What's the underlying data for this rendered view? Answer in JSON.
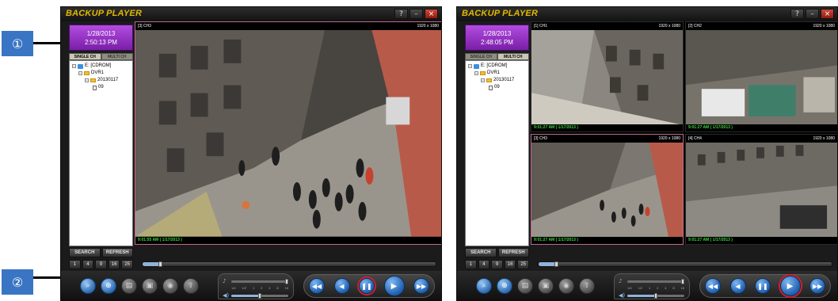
{
  "callouts": [
    "①",
    "②"
  ],
  "windows": [
    {
      "title": "BACKUP PLAYER",
      "controls": [
        "?",
        "–",
        "×"
      ],
      "date": "1/28/2013",
      "time": "2:50:13 PM",
      "tabs": [
        "SINGLE CH",
        "MULTI CH"
      ],
      "active_tab": "SINGLE CH",
      "tree": [
        "E: [CDROM]",
        "DVR1",
        "20130117",
        "09"
      ],
      "search_label": "SEARCH",
      "refresh_label": "REFRESH",
      "split_buttons": [
        "1",
        "4",
        "9",
        "16",
        "25"
      ],
      "timeline_position": 0.06,
      "volume_position": 0.5,
      "speed_position": 0.97,
      "volume_ticks": [
        "1/4",
        "1/2",
        "1",
        "2",
        "4",
        "8",
        "16"
      ],
      "layout": "single",
      "panes": [
        {
          "channel": "[3] CH3",
          "resolution": "1920 x 1080",
          "timestamp": "9:01:55 AM ( 1/17/2013 )",
          "border_color": "#c16a8c"
        }
      ],
      "icon_group": [
        "search-icon",
        "zoom-icon",
        "print-icon",
        "save-icon",
        "camera-icon",
        "export-icon"
      ],
      "highlighted_play_button": "pause",
      "colors": {
        "title": "#e3b800",
        "date_box": "#9b33c9",
        "timestamp": "#3bd63b",
        "play_ring": "#d01f2b"
      }
    },
    {
      "title": "BACKUP PLAYER",
      "controls": [
        "?",
        "–",
        "×"
      ],
      "date": "1/28/2013",
      "time": "2:48:05 PM",
      "tabs": [
        "SINGLE CH",
        "MULTI CH"
      ],
      "active_tab": "MULTI CH",
      "tree": [
        "E: [CDROM]",
        "DVR1",
        "20130117",
        "09"
      ],
      "search_label": "SEARCH",
      "refresh_label": "REFRESH",
      "split_buttons": [
        "1",
        "4",
        "9",
        "16",
        "25"
      ],
      "timeline_position": 0.06,
      "volume_position": 0.5,
      "speed_position": 0.97,
      "volume_ticks": [
        "1/4",
        "1/2",
        "1",
        "2",
        "4",
        "8",
        "16"
      ],
      "layout": "quad",
      "panes": [
        {
          "channel": "[1] CH1",
          "resolution": "1920 x 1080",
          "timestamp": "9:01:27 AM ( 1/17/2013 )",
          "border_color": "#2a2a2a"
        },
        {
          "channel": "[2] CH2",
          "resolution": "1920 x 1080",
          "timestamp": "9:01:27 AM ( 1/17/2013 )",
          "border_color": "#2a2a2a"
        },
        {
          "channel": "[3] CH3",
          "resolution": "1920 x 1080",
          "timestamp": "9:01:27 AM ( 1/17/2013 )",
          "border_color": "#c16a8c"
        },
        {
          "channel": "[4] CH4",
          "resolution": "1920 x 1080",
          "timestamp": "9:01:27 AM ( 1/17/2013 )",
          "border_color": "#2a2a2a"
        }
      ],
      "icon_group": [
        "search-icon",
        "zoom-icon",
        "print-icon",
        "save-icon",
        "camera-icon",
        "export-icon"
      ],
      "highlighted_play_button": "play",
      "colors": {
        "title": "#e3b800",
        "date_box": "#9b33c9",
        "timestamp": "#3bd63b",
        "play_ring": "#d01f2b"
      }
    }
  ]
}
